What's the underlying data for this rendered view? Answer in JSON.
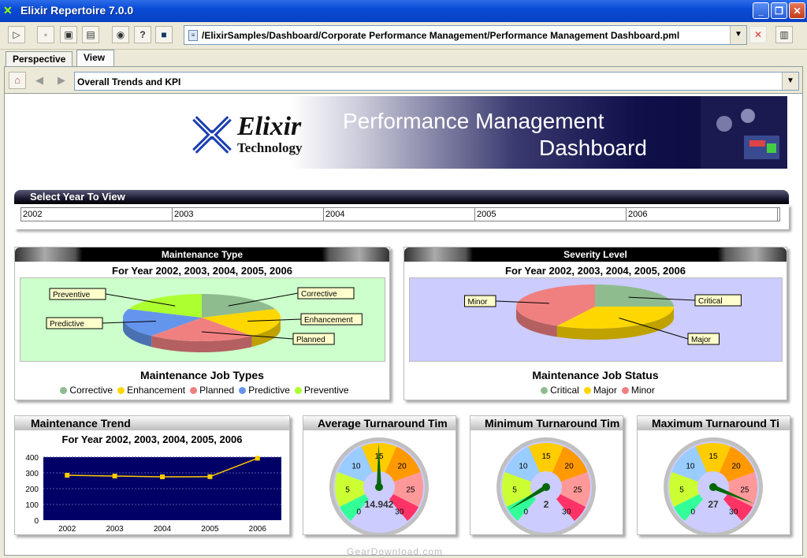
{
  "window": {
    "title": "Elixir Repertoire 7.0.0"
  },
  "toolbar": {
    "path": "/ElixirSamples/Dashboard/Corporate Performance Management/Performance Management Dashboard.pml"
  },
  "tabs": [
    {
      "label": "Perspective"
    },
    {
      "label": "View"
    }
  ],
  "nav": {
    "view": "Overall Trends and KPI"
  },
  "banner": {
    "brand": "Elixir",
    "brand_sub": "Technology",
    "title1": "Performance Management",
    "title2": "Dashboard"
  },
  "year_select": {
    "label": "Select Year To View",
    "years": [
      "2002",
      "2003",
      "2004",
      "2005",
      "2006"
    ]
  },
  "maintenance_type": {
    "title": "Maintenance Type",
    "subtitle": "For Year 2002, 2003, 2004, 2005, 2006",
    "chart_title": "Maintenance Job Types",
    "legend": [
      {
        "label": "Corrective",
        "color": "#8fbc8f"
      },
      {
        "label": "Enhancement",
        "color": "#ffd700"
      },
      {
        "label": "Planned",
        "color": "#f08080"
      },
      {
        "label": "Predictive",
        "color": "#6495ed"
      },
      {
        "label": "Preventive",
        "color": "#adff2f"
      }
    ]
  },
  "severity": {
    "title": "Severity Level",
    "subtitle": "For Year 2002, 2003, 2004, 2005, 2006",
    "chart_title": "Maintenance Job Status",
    "legend": [
      {
        "label": "Critical",
        "color": "#8fbc8f"
      },
      {
        "label": "Major",
        "color": "#ffd700"
      },
      {
        "label": "Minor",
        "color": "#f08080"
      }
    ]
  },
  "trend": {
    "title": "Maintenance Trend",
    "subtitle": "For Year 2002, 2003, 2004, 2005, 2006"
  },
  "gauges": [
    {
      "title": "Average Turnaround Tim",
      "value": 14.942,
      "label": "14.942"
    },
    {
      "title": "Minimum Turnaround Tim",
      "value": 2,
      "label": "2"
    },
    {
      "title": "Maximum Turnaround Ti",
      "value": 27,
      "label": "27"
    }
  ],
  "gauge_ticks": [
    "0",
    "5",
    "10",
    "15",
    "20",
    "25",
    "30"
  ],
  "watermark": "GearDownload.com",
  "chart_data": [
    {
      "type": "pie",
      "title": "Maintenance Job Types",
      "categories": [
        "Corrective",
        "Enhancement",
        "Planned",
        "Predictive",
        "Preventive"
      ],
      "values": [
        19,
        20,
        22,
        20,
        19
      ]
    },
    {
      "type": "pie",
      "title": "Maintenance Job Status",
      "categories": [
        "Critical",
        "Major",
        "Minor"
      ],
      "values": [
        25,
        33,
        42
      ]
    },
    {
      "type": "line",
      "title": "For Year 2002, 2003, 2004, 2005, 2006",
      "x": [
        "2002",
        "2003",
        "2004",
        "2005",
        "2006"
      ],
      "values": [
        285,
        280,
        275,
        276,
        393
      ],
      "ylim": [
        0,
        400
      ],
      "yticks": [
        "0",
        "100",
        "200",
        "300",
        "400"
      ],
      "grid": true
    }
  ]
}
